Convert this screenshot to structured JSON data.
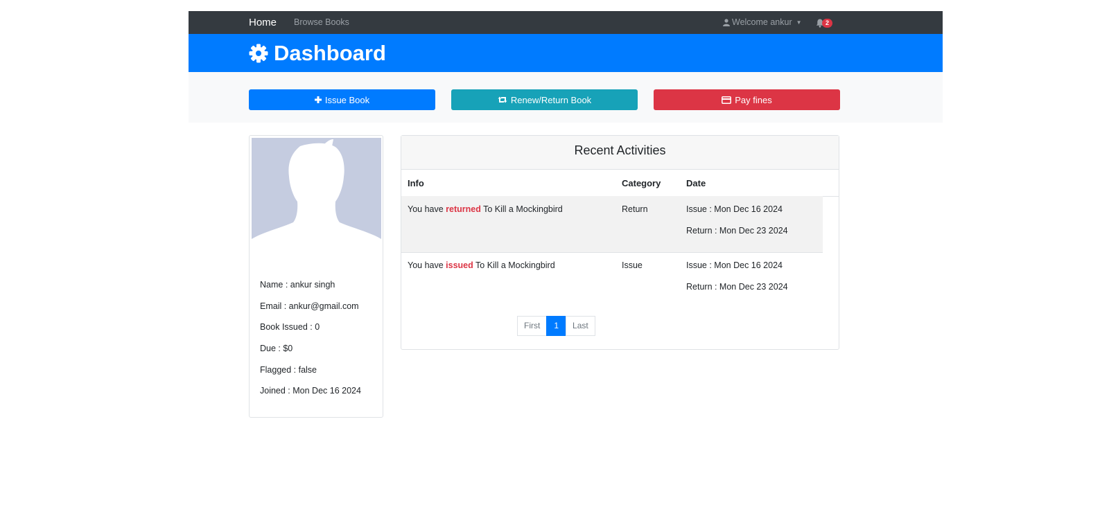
{
  "navbar": {
    "home": "Home",
    "browse": "Browse Books",
    "welcome": "Welcome ankur",
    "notification_count": "2"
  },
  "header": {
    "title": "Dashboard"
  },
  "actions": {
    "issue": "Issue Book",
    "renew": "Renew/Return Book",
    "fines": "Pay fines"
  },
  "profile": {
    "name": "Name : ankur singh",
    "email": "Email : ankur@gmail.com",
    "issued": "Book Issued : 0",
    "due": "Due : $0",
    "flagged": "Flagged : false",
    "joined": "Joined : Mon Dec 16 2024"
  },
  "activities": {
    "title": "Recent Activities",
    "columns": [
      "Info",
      "Category",
      "Date"
    ],
    "rows": [
      {
        "prefix": "You have ",
        "action": "returned",
        "book": " To Kill a Mockingbird",
        "category": "Return",
        "issue_date": "Issue : Mon Dec 16 2024",
        "return_date": "Return : Mon Dec 23 2024"
      },
      {
        "prefix": "You have ",
        "action": "issued",
        "book": " To Kill a Mockingbird",
        "category": "Issue",
        "issue_date": "Issue : Mon Dec 16 2024",
        "return_date": "Return : Mon Dec 23 2024"
      }
    ],
    "pagination": {
      "first": "First",
      "current": "1",
      "last": "Last"
    }
  },
  "colors": {
    "navbar": "#343a40",
    "primary": "#007bff",
    "info": "#17a2b8",
    "danger": "#dc3545"
  }
}
